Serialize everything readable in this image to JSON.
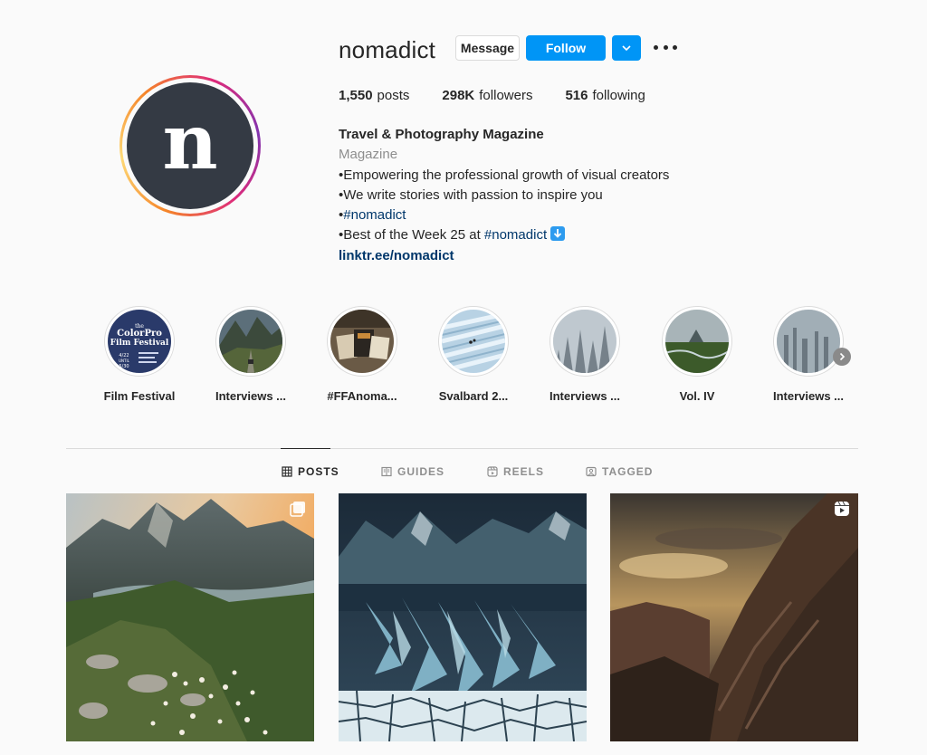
{
  "profile": {
    "username": "nomadict",
    "avatar_letter": "n",
    "buttons": {
      "message": "Message",
      "follow": "Follow"
    },
    "stats": {
      "posts_count": "1,550",
      "posts_label": "posts",
      "followers_count": "298K",
      "followers_label": "followers",
      "following_count": "516",
      "following_label": "following"
    },
    "bio": {
      "name": "Travel & Photography Magazine",
      "category": "Magazine",
      "line1": "•Empowering the professional growth of visual creators",
      "line2": "•We write stories with passion to inspire you",
      "line3_prefix": "•",
      "line3_tag": "#nomadict",
      "line4_prefix": "•Best of the Week 25 at ",
      "line4_tag": "#nomadict",
      "link": "linktr.ee/nomadict"
    }
  },
  "highlights": [
    {
      "label": "Film Festival",
      "cover_text": [
        "the",
        "ColorPro",
        "Film Festival",
        "4/22",
        "UNTIL",
        "5/30"
      ]
    },
    {
      "label": "Interviews ..."
    },
    {
      "label": "#FFAnoma..."
    },
    {
      "label": "Svalbard 2..."
    },
    {
      "label": "Interviews ..."
    },
    {
      "label": "Vol. IV"
    },
    {
      "label": "Interviews ..."
    }
  ],
  "tabs": [
    {
      "label": "POSTS",
      "icon": "grid-icon",
      "active": true
    },
    {
      "label": "GUIDES",
      "icon": "guides-icon",
      "active": false
    },
    {
      "label": "REELS",
      "icon": "reels-icon",
      "active": false
    },
    {
      "label": "TAGGED",
      "icon": "tagged-icon",
      "active": false
    }
  ],
  "posts": [
    {
      "subject": "mountain valley at sunset with white flowers",
      "badge": "carousel-icon"
    },
    {
      "subject": "blue glacier ice over frozen lake",
      "badge": null
    },
    {
      "subject": "dark rocky mountain slope under dramatic sky",
      "badge": "reel-icon"
    }
  ],
  "colors": {
    "follow_blue": "#0095f6",
    "link_blue": "#00376b",
    "avatar_bg": "#343a44",
    "text_primary": "#262626",
    "text_secondary": "#8e8e8e"
  }
}
